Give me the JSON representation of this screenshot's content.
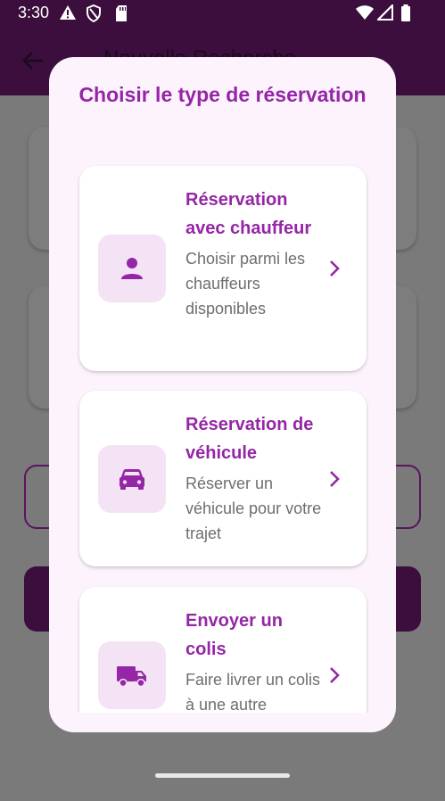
{
  "status_bar": {
    "time": "3:30"
  },
  "app_bar": {
    "title": "Nouvelle Recherche",
    "back_icon": "arrow-back-icon"
  },
  "dialog": {
    "title": "Choisir le type de réservation",
    "options": [
      {
        "title": "Réservation avec chauffeur",
        "description": "Choisir parmi les chauffeurs disponibles",
        "icon": "person-icon"
      },
      {
        "title": "Réservation de véhicule",
        "description": "Réserver un véhicule pour votre trajet",
        "icon": "car-icon"
      },
      {
        "title": "Envoyer un colis",
        "description": "Faire livrer un colis à une autre",
        "icon": "truck-icon"
      }
    ]
  },
  "colors": {
    "accent": "#9526a6",
    "dialog_bg": "#fcf3fd",
    "icon_tile": "#f3e3f5"
  }
}
